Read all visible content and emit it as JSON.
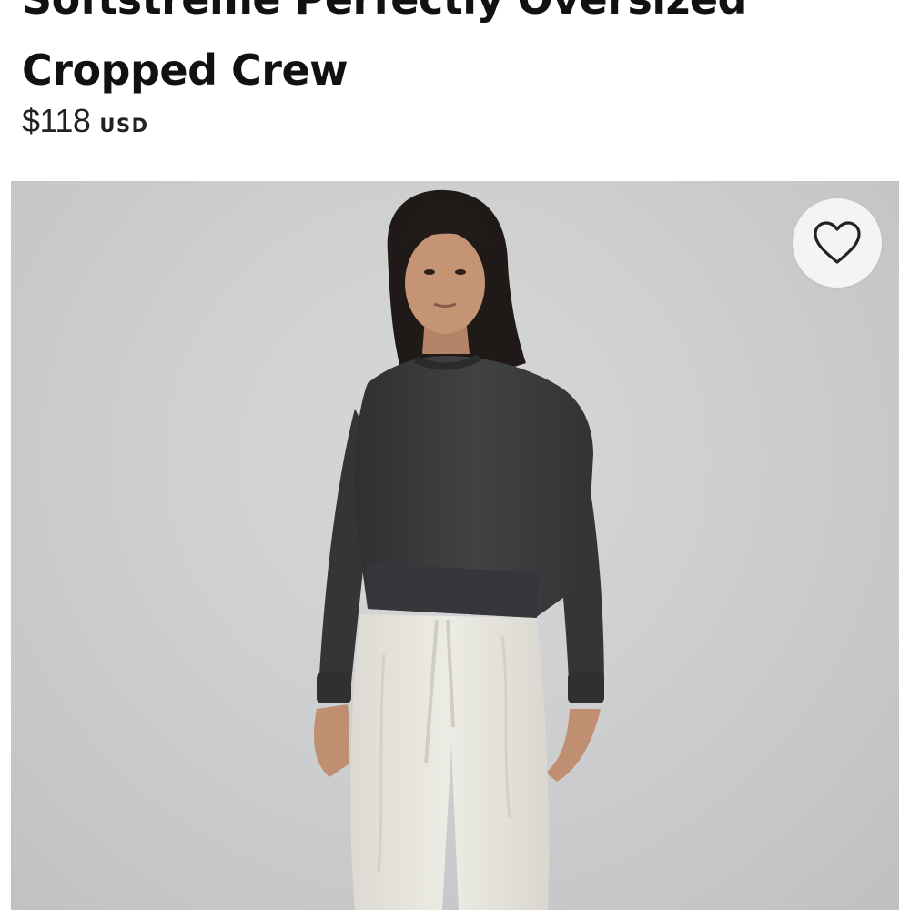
{
  "product": {
    "title_line_1": "Softstreme Perfectly Oversized",
    "title_line_2": "Cropped Crew",
    "price": "$118",
    "currency": "USD"
  },
  "gallery": {
    "wishlist_icon": "heart-outline-icon",
    "colors": {
      "background": "#cfd0d1",
      "sweater": "#3a3b3d",
      "pants": "#e6e4dc",
      "hair": "#1f1a18",
      "skin": "#c08f72"
    }
  }
}
